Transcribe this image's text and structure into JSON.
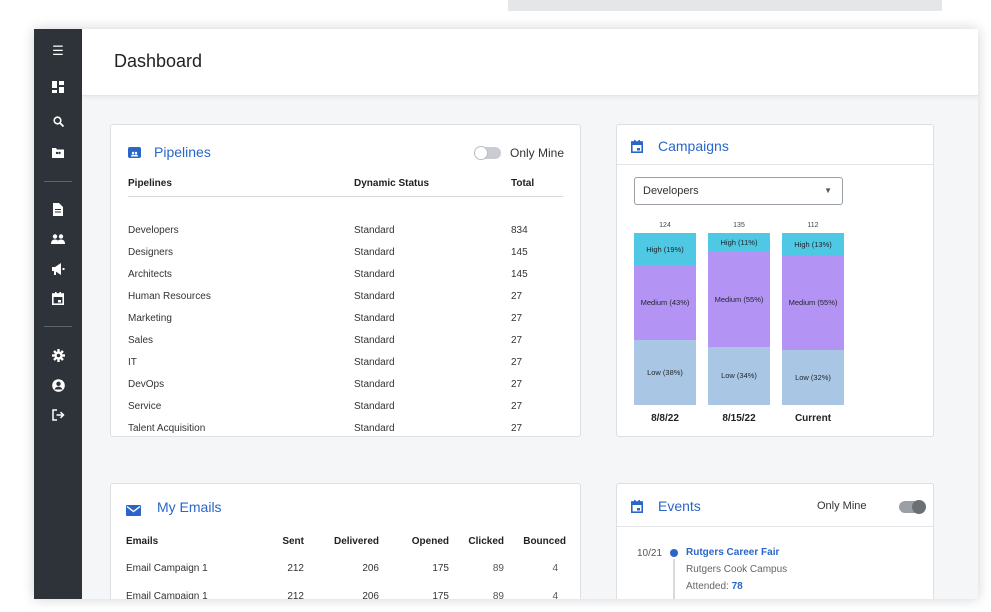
{
  "header": {
    "title": "Dashboard"
  },
  "sidebar": {
    "icons": [
      "menu-icon",
      "dashboard-icon",
      "search-icon",
      "pipelines-icon",
      "document-icon",
      "people-icon",
      "megaphone-icon",
      "calendar-icon",
      "gear-icon",
      "account-icon",
      "logout-icon"
    ]
  },
  "pipelines": {
    "title": "Pipelines",
    "toggle_label": "Only Mine",
    "columns": [
      "Pipelines",
      "Dynamic Status",
      "Total"
    ],
    "rows": [
      {
        "name": "Developers",
        "status": "Standard",
        "total": "834"
      },
      {
        "name": "Designers",
        "status": "Standard",
        "total": "145"
      },
      {
        "name": "Architects",
        "status": "Standard",
        "total": "145"
      },
      {
        "name": "Human Resources",
        "status": "Standard",
        "total": "27"
      },
      {
        "name": "Marketing",
        "status": "Standard",
        "total": "27"
      },
      {
        "name": "Sales",
        "status": "Standard",
        "total": "27"
      },
      {
        "name": "IT",
        "status": "Standard",
        "total": "27"
      },
      {
        "name": "DevOps",
        "status": "Standard",
        "total": "27"
      },
      {
        "name": "Service",
        "status": "Standard",
        "total": "27"
      },
      {
        "name": "Talent Acquisition",
        "status": "Standard",
        "total": "27"
      }
    ]
  },
  "campaigns": {
    "title": "Campaigns",
    "selected": "Developers",
    "colors": {
      "high": "#4fc8e4",
      "medium": "#b394f5",
      "low": "#a9c7e4"
    }
  },
  "chart_data": {
    "type": "bar",
    "stacked": true,
    "categories": [
      "8/8/22",
      "8/15/22",
      "Current"
    ],
    "totals": [
      124,
      135,
      112
    ],
    "series": [
      {
        "name": "Low",
        "values": [
          38,
          34,
          32
        ],
        "labels": [
          "Low (38%)",
          "Low (34%)",
          "Low (32%)"
        ]
      },
      {
        "name": "Medium",
        "values": [
          43,
          55,
          55
        ],
        "labels": [
          "Medium (43%)",
          "Medium (55%)",
          "Medium (55%)"
        ]
      },
      {
        "name": "High",
        "values": [
          19,
          11,
          13
        ],
        "labels": [
          "High (19%)",
          "High (11%)",
          "High (13%)"
        ]
      }
    ]
  },
  "emails": {
    "title": "My Emails",
    "columns": [
      "Emails",
      "Sent",
      "Delivered",
      "Opened",
      "Clicked",
      "Bounced"
    ],
    "rows": [
      {
        "name": "Email Campaign 1",
        "sent": "212",
        "delivered": "206",
        "opened": "175",
        "clicked": "89",
        "bounced": "4"
      },
      {
        "name": "Email Campaign 1",
        "sent": "212",
        "delivered": "206",
        "opened": "175",
        "clicked": "89",
        "bounced": "4"
      }
    ]
  },
  "events": {
    "title": "Events",
    "toggle_label": "Only Mine",
    "items": [
      {
        "date": "10/21",
        "title": "Rutgers Career Fair",
        "location": "Rutgers Cook Campus",
        "attended_label": "Attended:",
        "attended": "78"
      }
    ]
  }
}
